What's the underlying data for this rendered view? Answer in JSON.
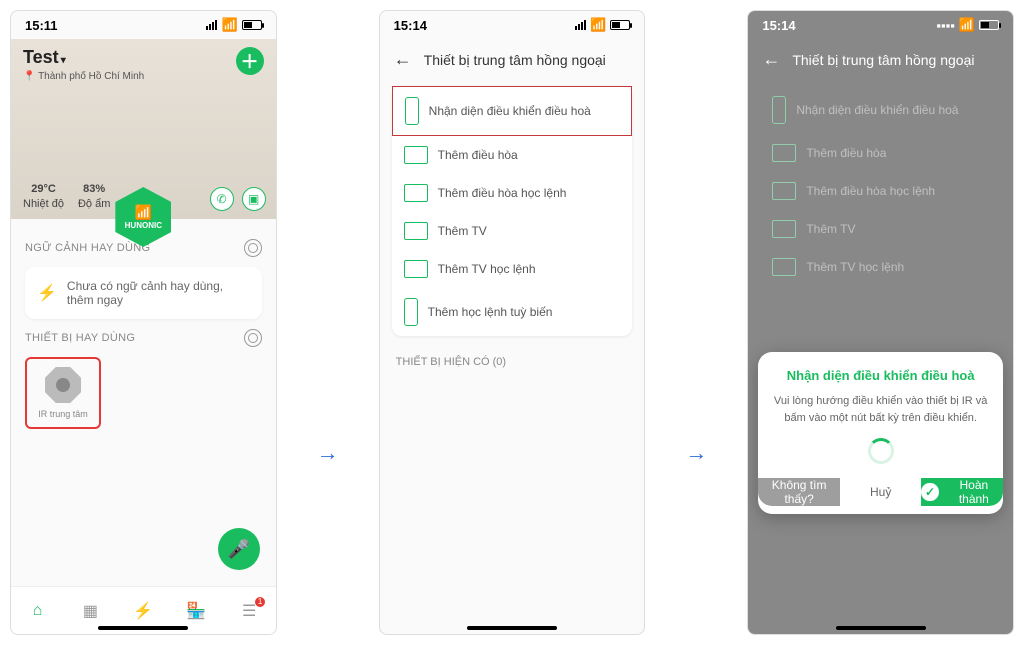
{
  "screen1": {
    "time": "15:11",
    "title": "Test",
    "location": "Thành phố Hồ Chí Minh",
    "temperature": "29°C",
    "temp_label": "Nhiệt độ",
    "humidity": "83%",
    "humidity_label": "Độ ẩm",
    "brand": "HUNONIC",
    "section_scenes": "NGỮ CẢNH HAY DÙNG",
    "no_scene_msg": "Chưa có ngữ cảnh hay dùng, thêm ngay",
    "section_devices": "THIẾT BỊ HAY DÙNG",
    "device_name": "IR trung tâm"
  },
  "screen2": {
    "time": "15:14",
    "header": "Thiết bị trung tâm hồng ngoại",
    "options": [
      "Nhận diện điều khiển điều hoà",
      "Thêm điều hòa",
      "Thêm điều hòa học lệnh",
      "Thêm TV",
      "Thêm TV học lệnh",
      "Thêm học lệnh tuỳ biến"
    ],
    "existing_header": "THIẾT BỊ HIỆN CÓ (0)"
  },
  "screen3": {
    "time": "15:14",
    "header": "Thiết bị trung tâm hồng ngoại",
    "options": [
      "Nhận diện điều khiển điều hoà",
      "Thêm điều hòa",
      "Thêm điều hòa học lệnh",
      "Thêm TV",
      "Thêm TV học lệnh"
    ],
    "modal_title": "Nhận diện điều khiển điều hoà",
    "modal_body": "Vui lòng hướng điều khiển vào thiết bị IR và bấm vào một nút bất kỳ trên điều khiển.",
    "btn_notfound": "Không tìm thấy?",
    "btn_cancel": "Huỷ",
    "btn_done": "Hoàn thành"
  }
}
